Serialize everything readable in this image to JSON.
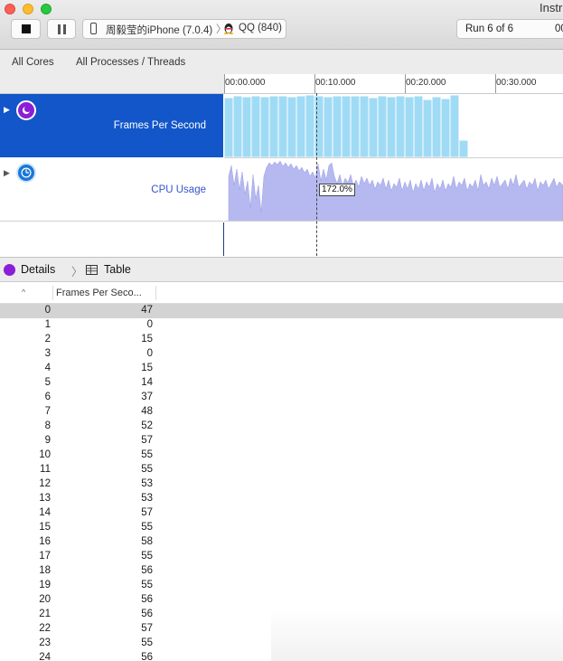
{
  "window": {
    "title": "Instr"
  },
  "toolbar": {
    "device": "周毅莹的iPhone (7.0.4)",
    "process": "QQ (840)",
    "run_label": "Run 6 of 6",
    "time": "00"
  },
  "filter": {
    "cores": "All Cores",
    "processes": "All Processes / Threads"
  },
  "ruler": {
    "ticks": [
      "00:00.000",
      "00:10.000",
      "00:20.000",
      "00:30.000"
    ]
  },
  "tracks": {
    "fps": {
      "title": "Frames Per Second",
      "color": "#1256c9"
    },
    "cpu": {
      "title": "CPU Usage",
      "tooltip": "172.0%"
    }
  },
  "details": {
    "details_label": "Details",
    "table_label": "Table"
  },
  "table": {
    "column": "Frames Per Seco...",
    "rows": [
      {
        "i": "0",
        "v": "47"
      },
      {
        "i": "1",
        "v": "0"
      },
      {
        "i": "2",
        "v": "15"
      },
      {
        "i": "3",
        "v": "0"
      },
      {
        "i": "4",
        "v": "15"
      },
      {
        "i": "5",
        "v": "14"
      },
      {
        "i": "6",
        "v": "37"
      },
      {
        "i": "7",
        "v": "48"
      },
      {
        "i": "8",
        "v": "52"
      },
      {
        "i": "9",
        "v": "57"
      },
      {
        "i": "10",
        "v": "55"
      },
      {
        "i": "11",
        "v": "55"
      },
      {
        "i": "12",
        "v": "53"
      },
      {
        "i": "13",
        "v": "53"
      },
      {
        "i": "14",
        "v": "57"
      },
      {
        "i": "15",
        "v": "55"
      },
      {
        "i": "16",
        "v": "58"
      },
      {
        "i": "17",
        "v": "55"
      },
      {
        "i": "18",
        "v": "56"
      },
      {
        "i": "19",
        "v": "55"
      },
      {
        "i": "20",
        "v": "56"
      },
      {
        "i": "21",
        "v": "56"
      },
      {
        "i": "22",
        "v": "57"
      },
      {
        "i": "23",
        "v": "55"
      },
      {
        "i": "24",
        "v": "56"
      }
    ]
  }
}
